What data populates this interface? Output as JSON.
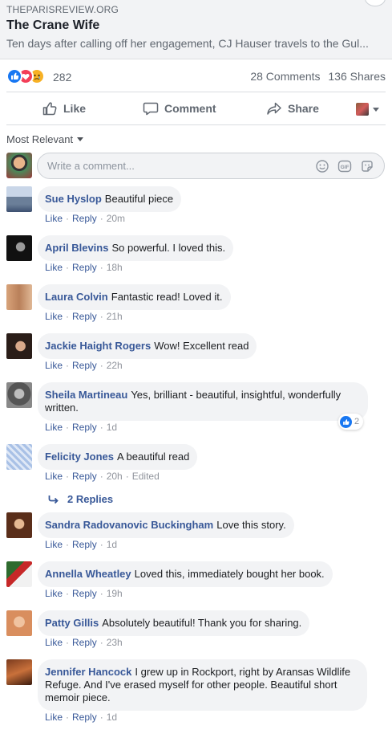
{
  "link_preview": {
    "domain": "THEPARISREVIEW.ORG",
    "title": "The Crane Wife",
    "description": "Ten days after calling off her engagement, CJ Hauser travels to the Gul..."
  },
  "stats": {
    "reaction_count": "282",
    "comments": "28 Comments",
    "shares": "136 Shares",
    "reaction_icons": [
      "like-icon",
      "love-icon",
      "sad-icon"
    ]
  },
  "actions": {
    "like": "Like",
    "comment": "Comment",
    "share": "Share"
  },
  "sort": {
    "label": "Most Relevant"
  },
  "composer": {
    "placeholder": "Write a comment..."
  },
  "comment_actions": {
    "like": "Like",
    "reply": "Reply"
  },
  "comments": [
    {
      "name": "Sue Hyslop",
      "text": "Beautiful piece",
      "time": "20m"
    },
    {
      "name": "April Blevins",
      "text": "So powerful. I loved this.",
      "time": "18h"
    },
    {
      "name": "Laura Colvin",
      "text": "Fantastic read! Loved it.",
      "time": "21h"
    },
    {
      "name": "Jackie Haight Rogers",
      "text": "Wow! Excellent read",
      "time": "22h"
    },
    {
      "name": "Sheila Martineau",
      "text": "Yes, brilliant - beautiful, insightful, wonderfully written.",
      "time": "1d",
      "likes": "2"
    },
    {
      "name": "Felicity Jones",
      "text": "A beautiful read",
      "time": "20h",
      "edited": "Edited",
      "replies": "2 Replies"
    },
    {
      "name": "Sandra Radovanovic Buckingham",
      "text": "Love this story.",
      "time": "1d"
    },
    {
      "name": "Annella Wheatley",
      "text": "Loved this, immediately bought her book.",
      "time": "19h"
    },
    {
      "name": "Patty Gillis",
      "text": "Absolutely beautiful! Thank you for sharing.",
      "time": "23h"
    },
    {
      "name": "Jennifer Hancock",
      "text": "I grew up in Rockport, right by Aransas Wildlife Refuge. And I've erased myself for other people. Beautiful short memoir piece.",
      "time": "1d"
    }
  ],
  "colors": {
    "link": "#385898",
    "bubble": "#f2f3f5",
    "like_blue": "#1877f2"
  }
}
